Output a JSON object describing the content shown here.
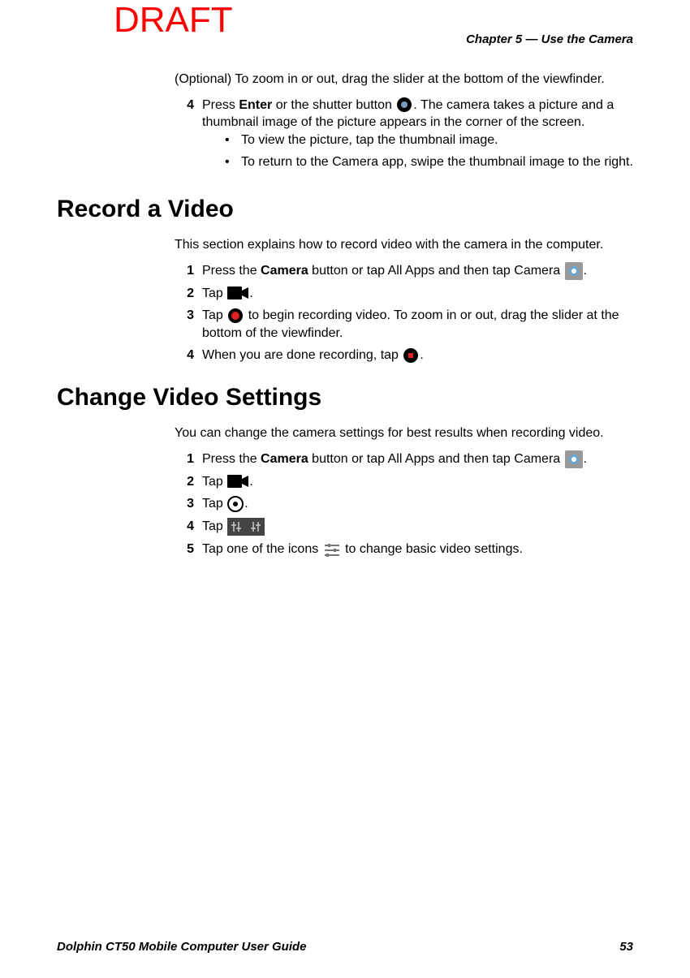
{
  "watermark": "DRAFT",
  "chapter_header": "Chapter 5 — Use the Camera",
  "top_block": {
    "optional_para": "(Optional) To zoom in or out, drag the slider at the bottom of the viewfinder.",
    "step4_pre": "Press ",
    "step4_bold": "Enter",
    "step4_mid": " or the shutter button ",
    "step4_post": ". The camera takes a picture and a thumbnail image of the picture appears in the corner of the screen.",
    "bullets": {
      "b1": "To view the picture, tap the thumbnail image.",
      "b2": "To return to the Camera app, swipe the thumbnail image to the right."
    }
  },
  "section_record": {
    "heading": "Record a Video",
    "intro": "This section explains how to record video with the camera in the computer.",
    "s1_pre": "Press the ",
    "s1_bold": "Camera",
    "s1_mid": " button or tap All Apps and then tap Camera ",
    "s1_post": ".",
    "s2_pre": "Tap ",
    "s2_post": ".",
    "s3_pre": "Tap ",
    "s3_post": " to begin recording video. To zoom in or out, drag the slider at the bottom of the viewfinder.",
    "s4_pre": "When you are done recording, tap ",
    "s4_post": "."
  },
  "section_change": {
    "heading": "Change Video Settings",
    "intro": "You can change the camera settings for best results when recording video.",
    "s1_pre": "Press the ",
    "s1_bold": "Camera",
    "s1_mid": " button or tap All Apps and then tap Camera ",
    "s1_post": ".",
    "s2_pre": "Tap ",
    "s2_post": ".",
    "s3_pre": "Tap ",
    "s3_post": ".",
    "s4_pre": "Tap ",
    "s5_pre": "Tap one of the icons ",
    "s5_post": " to change basic video settings."
  },
  "footer": {
    "title": "Dolphin CT50 Mobile Computer User Guide",
    "pagenum": "53"
  },
  "nums": {
    "n1": "1",
    "n2": "2",
    "n3": "3",
    "n4": "4",
    "n5": "5"
  }
}
